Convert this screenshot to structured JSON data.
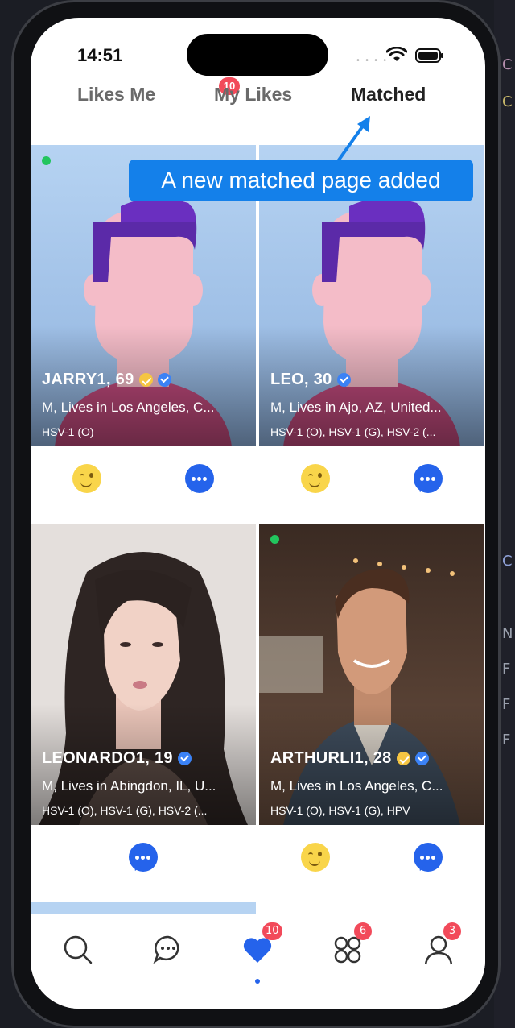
{
  "status_bar": {
    "time": "14:51"
  },
  "tabs": [
    {
      "label": "Likes Me",
      "badge": "10",
      "active": false
    },
    {
      "label": "My Likes",
      "active": false
    },
    {
      "label": "Matched",
      "active": true
    }
  ],
  "annotation": {
    "text": "A new matched page added",
    "color": "#1480ea"
  },
  "cards": [
    {
      "name": "JARRY1, 69",
      "online": true,
      "gold_badge": true,
      "verified": true,
      "location": "M, Lives in Los Angeles, C...",
      "tags": "HSV-1 (O)",
      "actions": [
        "wink",
        "chat"
      ]
    },
    {
      "name": "LEO, 30",
      "online": false,
      "gold_badge": false,
      "verified": true,
      "location": "M, Lives in Ajo, AZ, United...",
      "tags": "HSV-1 (O), HSV-1 (G), HSV-2 (...",
      "actions": [
        "wink",
        "chat"
      ]
    },
    {
      "name": "LEONARDO1, 19",
      "online": false,
      "gold_badge": false,
      "verified": true,
      "location": "M, Lives in Abingdon, IL, U...",
      "tags": "HSV-1 (O), HSV-1 (G), HSV-2 (...",
      "actions": [
        "chat"
      ]
    },
    {
      "name": "ARTHURLI1, 28",
      "online": true,
      "gold_badge": true,
      "verified": true,
      "location": "M, Lives in Los Angeles, C...",
      "tags": "HSV-1 (O), HSV-1 (G), HPV",
      "actions": [
        "wink",
        "chat"
      ]
    }
  ],
  "bottom_nav": [
    {
      "icon": "search-icon",
      "badge": ""
    },
    {
      "icon": "chat-bubble-icon",
      "badge": ""
    },
    {
      "icon": "heart-icon",
      "badge": "10",
      "active": true
    },
    {
      "icon": "apps-grid-icon",
      "badge": "6"
    },
    {
      "icon": "profile-icon",
      "badge": "3"
    }
  ],
  "colors": {
    "accent": "#2563eb",
    "badge": "#f24a5a",
    "online": "#22c55e"
  }
}
